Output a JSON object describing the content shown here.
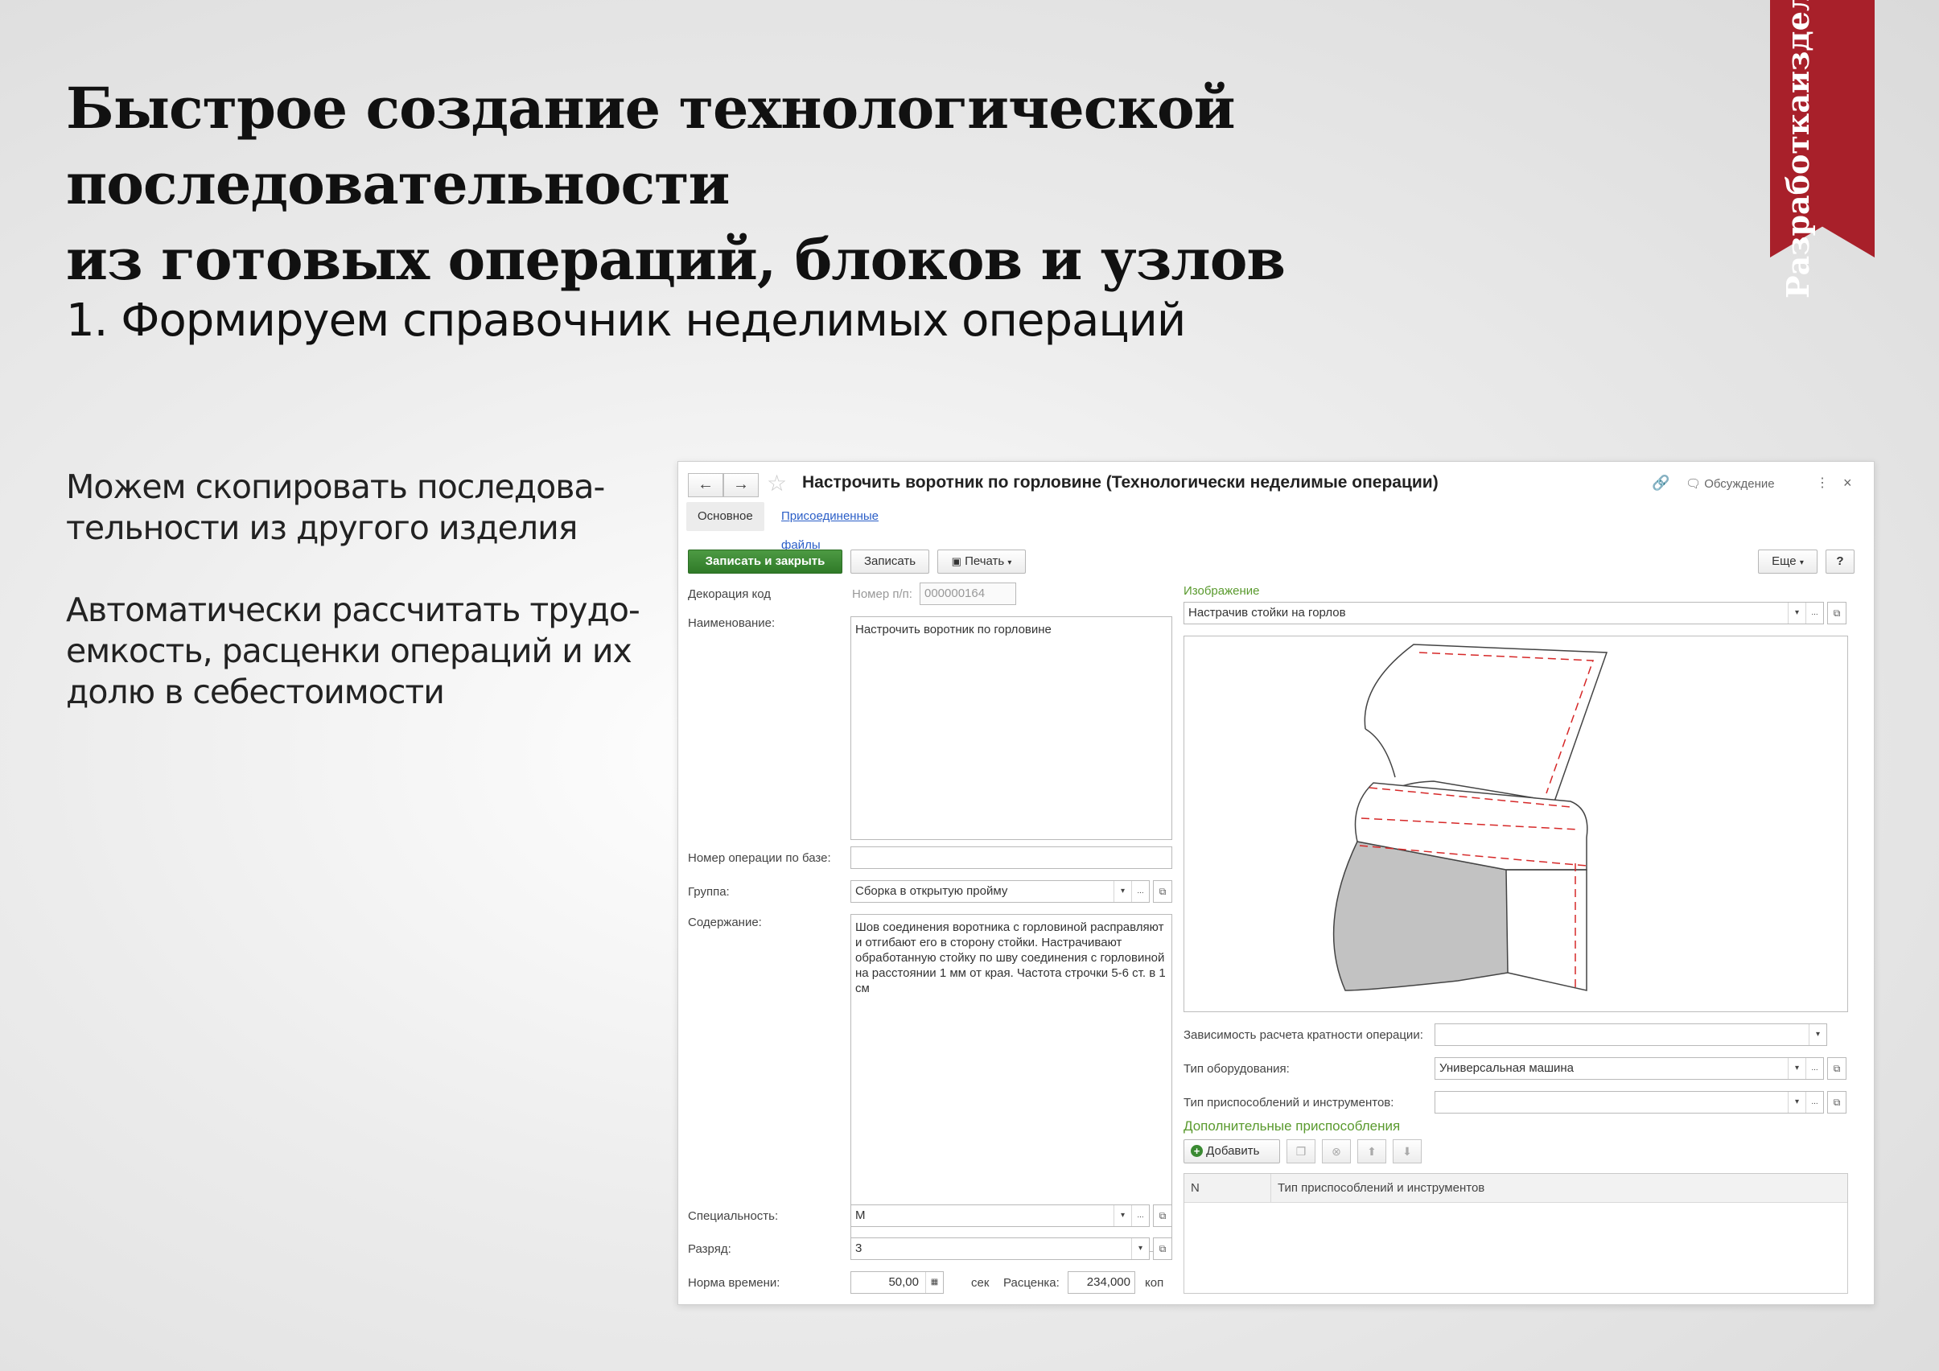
{
  "slide": {
    "title_lines": [
      "Быстрое создание технологической последовательности",
      "из готовых операций, блоков и узлов"
    ],
    "ribbon_lines": [
      "Разработка",
      "изделий"
    ],
    "subtitle": "1. Формируем справочник неделимых операций",
    "paragraph1_lines": [
      "Можем скопировать последова-",
      "тельности  из другого изделия"
    ],
    "paragraph2_lines": [
      "Автоматически рассчитать трудо-",
      "емкость, расценки операций и их",
      "долю в себестоимости"
    ],
    "accent_color": "#a8202a"
  },
  "window": {
    "title": "Настрочить воротник по горловине (Технологически неделимые операции)",
    "nav_back": "←",
    "nav_forward": "→",
    "star": "☆",
    "link_icon": "🔗",
    "discussion": "Обсуждение",
    "more_icon": "⋮",
    "close_icon": "×",
    "tabs": {
      "main": "Основное",
      "attached": "Присоединенные файлы"
    },
    "toolbar": {
      "save_close": "Записать и закрыть",
      "save": "Записать",
      "print": "Печать",
      "more": "Еще",
      "help": "?"
    },
    "form": {
      "decoration_code_label": "Декорация код",
      "number_label": "Номер п/п:",
      "number_value": "000000164",
      "name_label": "Наименование:",
      "name_value": "Настрочить воротник по горловине",
      "base_number_label": "Номер операции по базе:",
      "base_number_value": "",
      "group_label": "Группа:",
      "group_value": "Сборка в открытую пройму",
      "content_label": "Содержание:",
      "content_value": "Шов соединения воротника с горловиной расправляют и отгибают его в сторону стойки. Настрачивают обработанную стойку по шву соединения с горловиной на расстоянии 1 мм от края. Частота строчки 5-6 ст. в 1 см",
      "specialty_label": "Специальность:",
      "specialty_value": "М",
      "grade_label": "Разряд:",
      "grade_value": "3",
      "time_norm_label": "Норма времени:",
      "time_norm_value": "50,00",
      "time_unit": "сек",
      "price_label": "Расценка:",
      "price_value": "234,000",
      "price_unit": "коп"
    },
    "right": {
      "image_section": "Изображение",
      "image_value": "Настрачив стойки на горлов",
      "dependency_label": "Зависимость расчета кратности операции:",
      "dependency_value": "",
      "equipment_label": "Тип оборудования:",
      "equipment_value": "Универсальная машина",
      "tools_label": "Тип приспособлений и инструментов:",
      "tools_value": "",
      "extra_section": "Дополнительные приспособления",
      "add_button": "Добавить",
      "table_columns": [
        "N",
        "Тип приспособлений и инструментов"
      ],
      "table_rows": []
    },
    "dropdown_glyph": "▾",
    "ellipsis": "...",
    "open_glyph": "⧉",
    "calendar_glyph": "▦"
  }
}
